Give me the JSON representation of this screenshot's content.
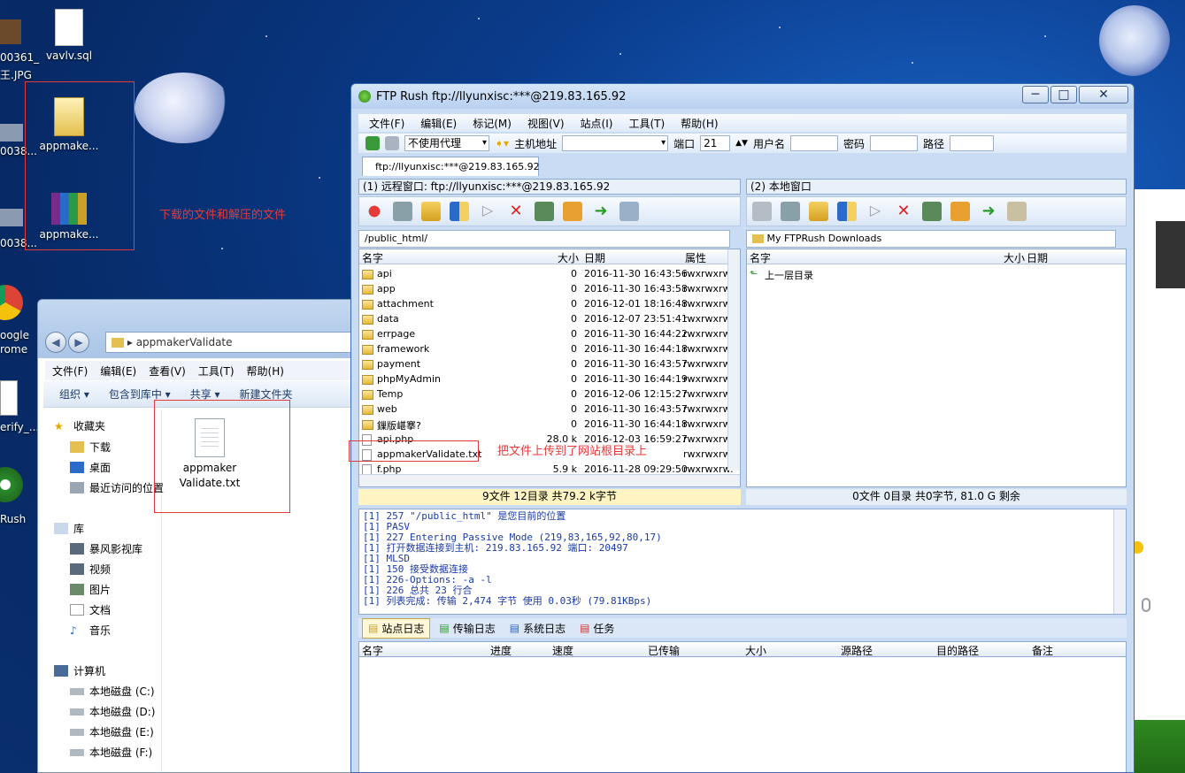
{
  "desktop": {
    "icons": [
      {
        "label": "vavlv.sql"
      },
      {
        "label": "appmake..."
      },
      {
        "label": "appmake..."
      }
    ],
    "cut_labels": {
      "top_left_1": "00361_",
      "top_left_2": "王.JPG",
      "left_mid_1": "0038...",
      "left_mid_2": "0038...",
      "google_1": "oogle",
      "google_2": "rome",
      "verify": "erify_...",
      "rush": "Rush"
    },
    "annotation_download": "下载的文件和解压的文件",
    "annotation_upload": "把文件上传到了网站根目录上"
  },
  "explorer": {
    "address": "appmakerValidate",
    "menu": [
      "文件(F)",
      "编辑(E)",
      "查看(V)",
      "工具(T)",
      "帮助(H)"
    ],
    "commands": [
      "组织 ▾",
      "包含到库中 ▾",
      "共享 ▾",
      "新建文件夹"
    ],
    "favorites_label": "收藏夹",
    "favorites": [
      "下载",
      "桌面",
      "最近访问的位置"
    ],
    "library_label": "库",
    "libraries": [
      "暴风影视库",
      "视频",
      "图片",
      "文档",
      "音乐"
    ],
    "computer_label": "计算机",
    "drives": [
      "本地磁盘 (C:)",
      "本地磁盘 (D:)",
      "本地磁盘 (E:)",
      "本地磁盘 (F:)"
    ],
    "file_name": "appmaker Validate.txt"
  },
  "ftp": {
    "title": "FTP Rush    ftp://llyunxisc:***@219.83.165.92",
    "menu": [
      "文件(F)",
      "编辑(E)",
      "标记(M)",
      "视图(V)",
      "站点(I)",
      "工具(T)",
      "帮助(H)"
    ],
    "proxy": "不使用代理",
    "host_label": "主机地址",
    "port_label": "端口",
    "port_value": "21",
    "user_label": "用户名",
    "pass_label": "密码",
    "path_label": "路径",
    "tab": "ftp://llyunxisc:***@219.83.165.92",
    "remote_header": "(1) 远程窗口: ftp://llyunxisc:***@219.83.165.92",
    "local_header": "(2) 本地窗口",
    "remote_path": "/public_html/",
    "local_path": "My FTPRush Downloads",
    "remote_columns": [
      "名字",
      "大小",
      "日期",
      "属性"
    ],
    "local_columns": [
      "名字",
      "大小",
      "日期"
    ],
    "remote_files": [
      {
        "name": "api",
        "size": "0",
        "date": "2016-11-30 16:43:56",
        "attr": "rwxrwxrw:",
        "type": "folder"
      },
      {
        "name": "app",
        "size": "0",
        "date": "2016-11-30 16:43:58",
        "attr": "rwxrwxrw:",
        "type": "folder"
      },
      {
        "name": "attachment",
        "size": "0",
        "date": "2016-12-01 18:16:48",
        "attr": "rwxrwxrw:",
        "type": "folder"
      },
      {
        "name": "data",
        "size": "0",
        "date": "2016-12-07 23:51:41",
        "attr": "rwxrwxrw:",
        "type": "folder"
      },
      {
        "name": "errpage",
        "size": "0",
        "date": "2016-11-30 16:44:22",
        "attr": "rwxrwxrw:",
        "type": "folder"
      },
      {
        "name": "framework",
        "size": "0",
        "date": "2016-11-30 16:44:18",
        "attr": "rwxrwxrw:",
        "type": "folder"
      },
      {
        "name": "payment",
        "size": "0",
        "date": "2016-11-30 16:43:57",
        "attr": "rwxrwxrw:",
        "type": "folder"
      },
      {
        "name": "phpMyAdmin",
        "size": "0",
        "date": "2016-11-30 16:44:19",
        "attr": "rwxrwxrw:",
        "type": "folder"
      },
      {
        "name": "Temp",
        "size": "0",
        "date": "2016-12-06 12:15:27",
        "attr": "rwxrwxrw:",
        "type": "folder"
      },
      {
        "name": "web",
        "size": "0",
        "date": "2016-11-30 16:43:57",
        "attr": "rwxrwxrw:",
        "type": "folder"
      },
      {
        "name": "鏁版嵁搴?",
        "size": "0",
        "date": "2016-11-30 16:44:18",
        "attr": "rwxrwxrw:",
        "type": "folder"
      },
      {
        "name": "api.php",
        "size": "28.0 k",
        "date": "2016-12-03 16:59:27",
        "attr": "rwxrwxrw:",
        "type": "file"
      },
      {
        "name": "appmakerValidate.txt",
        "size": "",
        "date": "",
        "attr": "rwxrwxrw:",
        "type": "file"
      },
      {
        "name": "f.php",
        "size": "5.9 k",
        "date": "2016-11-28 09:29:50",
        "attr": "rwxrwxrw:",
        "type": "file"
      }
    ],
    "local_files": [
      {
        "name": "上一层目录"
      }
    ],
    "remote_status": "9文件 12目录 共79.2 k字节",
    "local_status": "0文件 0目录 共0字节, 81.0 G 剩余",
    "log": [
      "[1] 257 \"/public_html\" 是您目前的位置",
      "[1] PASV",
      "[1] 227 Entering Passive Mode (219,83,165,92,80,17)",
      "[1] 打开数据连接到主机: 219.83.165.92 端口: 20497",
      "[1] MLSD",
      "[1] 150 接受数据连接",
      "[1] 226-Options: -a -l",
      "[1] 226 总共 23 行合",
      "[1] 列表完成: 传输 2,474 字节 使用 0.03秒 (79.81KBps)"
    ],
    "bottom_tabs": [
      "站点日志",
      "传输日志",
      "系统日志",
      "任务"
    ],
    "queue_columns": [
      "名字",
      "进度",
      "速度",
      "已传输",
      "大小",
      "源路径",
      "目的路径",
      "备注"
    ]
  }
}
